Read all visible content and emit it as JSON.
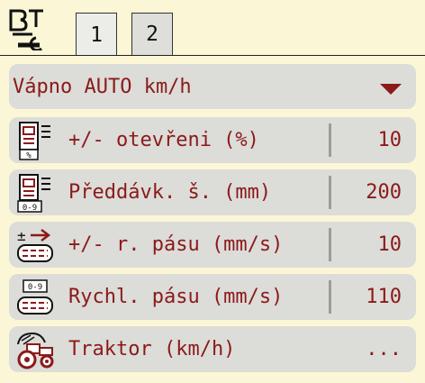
{
  "tabs": [
    {
      "label": "1",
      "active": true
    },
    {
      "label": "2",
      "active": false
    }
  ],
  "dropdown": {
    "selected": "Vápno AUTO km/h"
  },
  "rows": [
    {
      "label": "+/- otevřeni (%)",
      "value": "10",
      "icon": "opening-percent-icon"
    },
    {
      "label": "Předdávk. š. (mm)",
      "value": "200",
      "icon": "pre-dosing-icon"
    },
    {
      "label": "+/- r. pásu (mm/s)",
      "value": "10",
      "icon": "belt-speed-adjust-icon"
    },
    {
      "label": "Rychl. pásu (mm/s)",
      "value": "110",
      "icon": "belt-speed-icon"
    },
    {
      "label": "Traktor (km/h)",
      "value": "...",
      "icon": "tractor-icon"
    }
  ],
  "colors": {
    "background": "#fbf7d6",
    "panel": "#dcdcd8",
    "text_accent": "#8b1a1a"
  }
}
